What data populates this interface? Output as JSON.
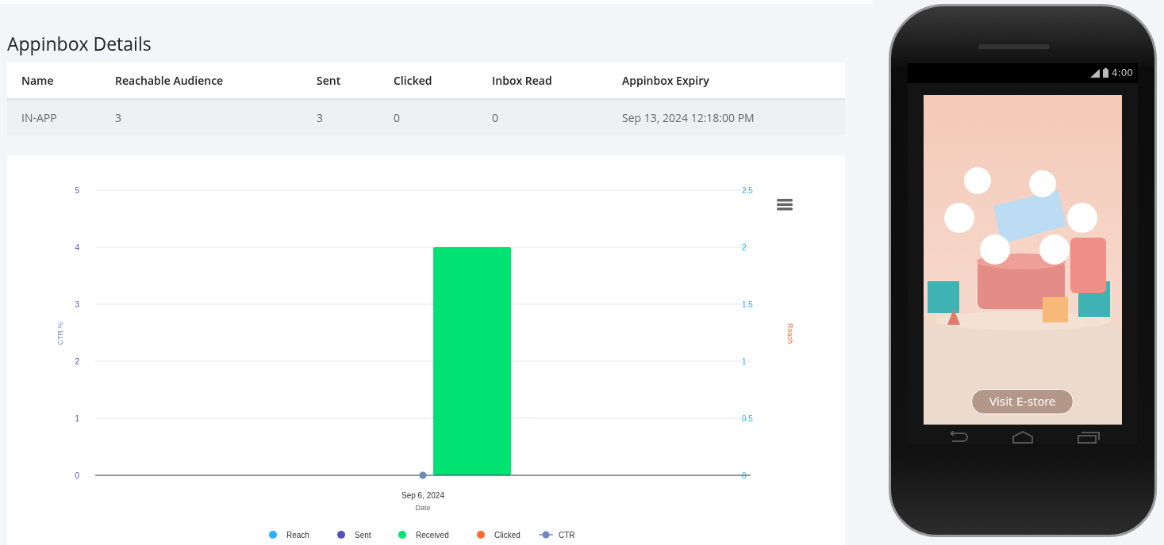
{
  "title": "Appinbox Details",
  "table": {
    "columns": [
      "Name",
      "Reachable Audience",
      "Sent",
      "Clicked",
      "Inbox Read",
      "Appinbox Expiry"
    ],
    "rows": [
      [
        "IN-APP",
        "3",
        "3",
        "0",
        "0",
        "Sep 13, 2024 12:18:00 PM"
      ]
    ]
  },
  "chart": {
    "chart_data": {
      "type": "bar",
      "grid": true,
      "xlabel": "Date",
      "ylabel": "CTR %",
      "y2label": "Reach",
      "categories": [
        "Sep 6, 2024"
      ],
      "ylim": [
        0,
        5
      ],
      "yticks": [
        0,
        1,
        2,
        3,
        4,
        5
      ],
      "y2ticks": [
        "0",
        "0.5",
        "1",
        "1.5",
        "2",
        "2.5"
      ],
      "series": [
        {
          "name": "Reach",
          "color": "#2caffe",
          "values": [
            0
          ]
        },
        {
          "name": "Sent",
          "color": "#544fc5",
          "values": [
            0
          ]
        },
        {
          "name": "Received",
          "color": "#00e272",
          "values": [
            4
          ]
        },
        {
          "name": "Clicked",
          "color": "#fe6a35",
          "values": [
            0
          ]
        },
        {
          "name": "CTR",
          "color": "#6b8abc",
          "values": [
            0
          ]
        }
      ]
    },
    "last_series_as_line": true
  },
  "phone": {
    "time": "4:00",
    "message": {
      "kind": "picture",
      "button": "Visit E-store"
    }
  }
}
